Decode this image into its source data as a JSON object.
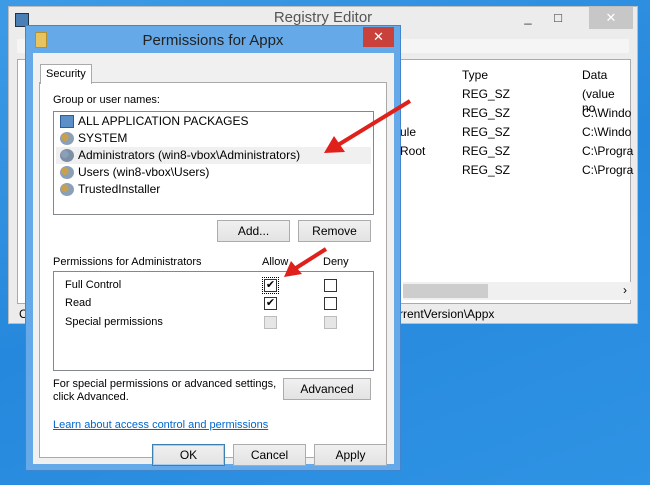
{
  "registry": {
    "title": "Registry Editor",
    "columns": {
      "type": "Type",
      "data": "Data"
    },
    "rows": [
      {
        "name": "",
        "type": "REG_SZ",
        "data": "(value no"
      },
      {
        "name": "",
        "type": "REG_SZ",
        "data": "C:\\Windo"
      },
      {
        "name": "ule",
        "type": "REG_SZ",
        "data": "C:\\Windo"
      },
      {
        "name": "Root",
        "type": "REG_SZ",
        "data": "C:\\Progra"
      },
      {
        "name": "",
        "type": "REG_SZ",
        "data": "C:\\Progra"
      }
    ],
    "status": "rrentVersion\\Appx",
    "status_left": "C"
  },
  "dialog": {
    "title": "Permissions for Appx",
    "tab": "Security",
    "group_label": "Group or user names:",
    "users": [
      "ALL APPLICATION PACKAGES",
      "SYSTEM",
      "Administrators (win8-vbox\\Administrators)",
      "Users (win8-vbox\\Users)",
      "TrustedInstaller"
    ],
    "add": "Add...",
    "remove": "Remove",
    "perm_label": "Permissions for Administrators",
    "allow": "Allow",
    "deny": "Deny",
    "perms": [
      {
        "name": "Full Control",
        "allow": true,
        "deny": false
      },
      {
        "name": "Read",
        "allow": true,
        "deny": false
      },
      {
        "name": "Special permissions",
        "allow": false,
        "deny": false
      }
    ],
    "advanced_text1": "For special permissions or advanced settings,",
    "advanced_text2": "click Advanced.",
    "advanced": "Advanced",
    "link": "Learn about access control and permissions",
    "ok": "OK",
    "cancel": "Cancel",
    "apply": "Apply"
  },
  "colors": {
    "arrow": "#e0201b",
    "titlebar": "#65a9e8"
  }
}
